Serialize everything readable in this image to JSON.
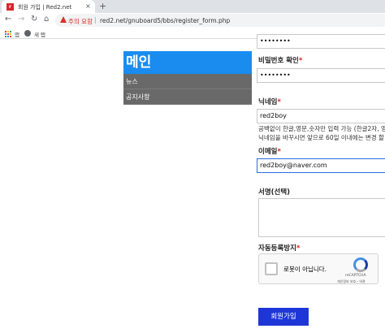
{
  "browser": {
    "tab_title": "회원 가입 | Red2.net",
    "tab_favicon_text": "r",
    "new_tab": "+",
    "tab_close": "×",
    "security_warning": "주의 요함",
    "url": "red2.net/gnuboard5/bbs/register_form.php",
    "bookmark_apps_label": "앱",
    "bookmark_new_label": "새 탭"
  },
  "sidebar": {
    "title": "메인",
    "items": [
      {
        "label": "뉴스"
      },
      {
        "label": "공지사항"
      }
    ]
  },
  "form": {
    "password_value": "••••••••",
    "password_confirm_label": "비밀번호 확인",
    "password_confirm_value": "••••••••",
    "required_mark": "*",
    "nickname_label": "닉네임",
    "nickname_value": "red2boy",
    "nickname_help_1": "공백없이 한글,영문,숫자만 입력 가능 (한글2자, 영",
    "nickname_help_2": "닉네임을 바꾸시면 앞으로 60일 이내에는 변경 할",
    "email_label": "이메일",
    "email_value": "red2boy@naver.com",
    "signature_label": "서명(선택)",
    "captcha_label": "자동등록방지",
    "captcha_checkbox_text": "로봇이 아닙니다.",
    "captcha_brand": "reCAPTCHA",
    "captcha_links": "개인정보 보호 - 약관",
    "submit_label": "회원가입"
  },
  "colors": {
    "menu_title_bg": "#1a8cf0",
    "menu_item_bg": "#696969",
    "submit_bg": "#1e36d8",
    "required": "#e02020",
    "warning": "#d93025"
  }
}
